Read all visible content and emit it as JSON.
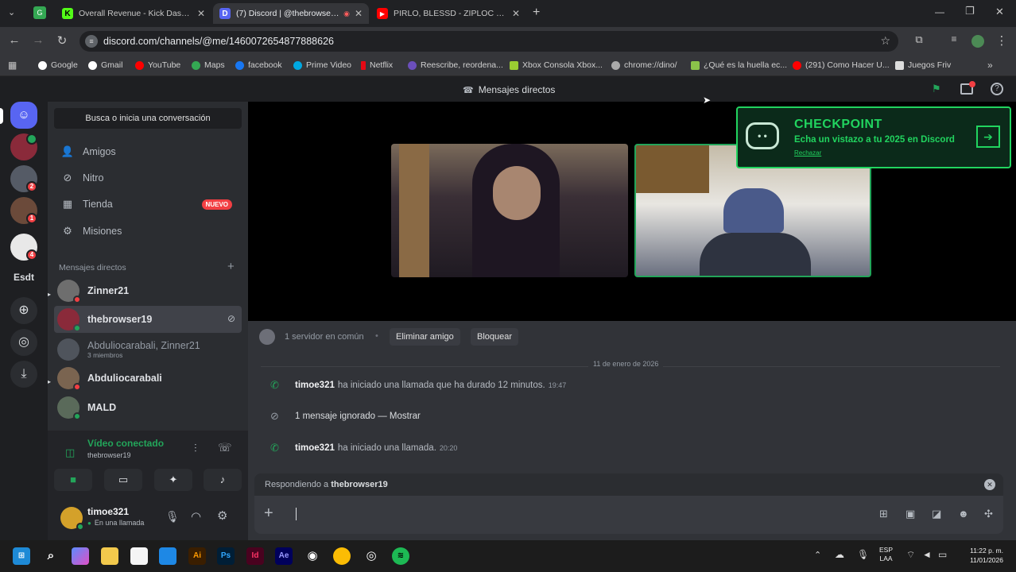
{
  "browser": {
    "tabs": [
      {
        "title": "Overall Revenue - Kick Dashboard",
        "favicon": "K",
        "color": "#53fc18"
      },
      {
        "title": "(7) Discord | @thebrowser19",
        "favicon": "D",
        "color": "#5865f2"
      },
      {
        "title": "PIRLO, BLESSD - ZIPLOC (SALSA)",
        "favicon": "▶",
        "color": "#ff0000"
      }
    ],
    "url": "discord.com/channels/@me/1460072654877888626",
    "bookmarks": [
      "Google",
      "Gmail",
      "YouTube",
      "Maps",
      "facebook",
      "Prime Video",
      "Netflix",
      "Reescribe, reordena...",
      "Xbox Consola Xbox...",
      "chrome://dino/",
      "¿Qué es la huella ec...",
      "(291) Como Hacer U...",
      "Juegos Friv"
    ]
  },
  "discord": {
    "title": "Mensajes directos",
    "servers": [
      {
        "badge": ""
      },
      {
        "badge": "2"
      },
      {
        "badge": "1"
      },
      {
        "badge": "4"
      }
    ],
    "server_label": "Esdt",
    "search_placeholder": "Busca o inicia una conversación",
    "nav": [
      {
        "label": "Amigos",
        "icon": "friends-icon"
      },
      {
        "label": "Nitro",
        "icon": "nitro-icon"
      },
      {
        "label": "Tienda",
        "icon": "shop-icon",
        "badge": "NUEVO"
      },
      {
        "label": "Misiones",
        "icon": "quests-icon"
      }
    ],
    "dm_header": "Mensajes directos",
    "dms": [
      {
        "name": "Zinner21",
        "sub": ""
      },
      {
        "name": "thebrowser19",
        "sub": ""
      },
      {
        "name": "Abduliocarabali, Zinner21",
        "sub": "3 miembros"
      },
      {
        "name": "Abduliocarabali",
        "sub": ""
      },
      {
        "name": "MALD",
        "sub": ""
      }
    ],
    "voice": {
      "status": "Vídeo conectado",
      "channel": "thebrowser19"
    },
    "user": {
      "name": "timoe321",
      "status": "En una llamada"
    },
    "checkpoint": {
      "title": "CHECKPOINT",
      "subtitle": "Echa un vistazo a tu 2025 en Discord",
      "dismiss": "Rechazar"
    },
    "profile_bar": {
      "mutual": "1 servidor en común",
      "remove_friend": "Eliminar amigo",
      "block": "Bloquear"
    },
    "date_divider": "11 de enero de 2026",
    "messages": [
      {
        "user": "timoe321",
        "text": "ha iniciado una llamada que ha durado 12 minutos.",
        "time": "19:47",
        "icon": "phone-icon"
      },
      {
        "user": "",
        "text": "1 mensaje ignorado — Mostrar",
        "time": "",
        "icon": "ignored-icon"
      },
      {
        "user": "timoe321",
        "text": "ha iniciado una llamada.",
        "time": "20:20",
        "icon": "phone-icon"
      }
    ],
    "reply": {
      "prefix": "Respondiendo a",
      "target": "thebrowser19"
    }
  },
  "taskbar": {
    "lang": "ESP",
    "layout": "LAA",
    "time": "11:22 p. m.",
    "date": "11/01/2026"
  }
}
